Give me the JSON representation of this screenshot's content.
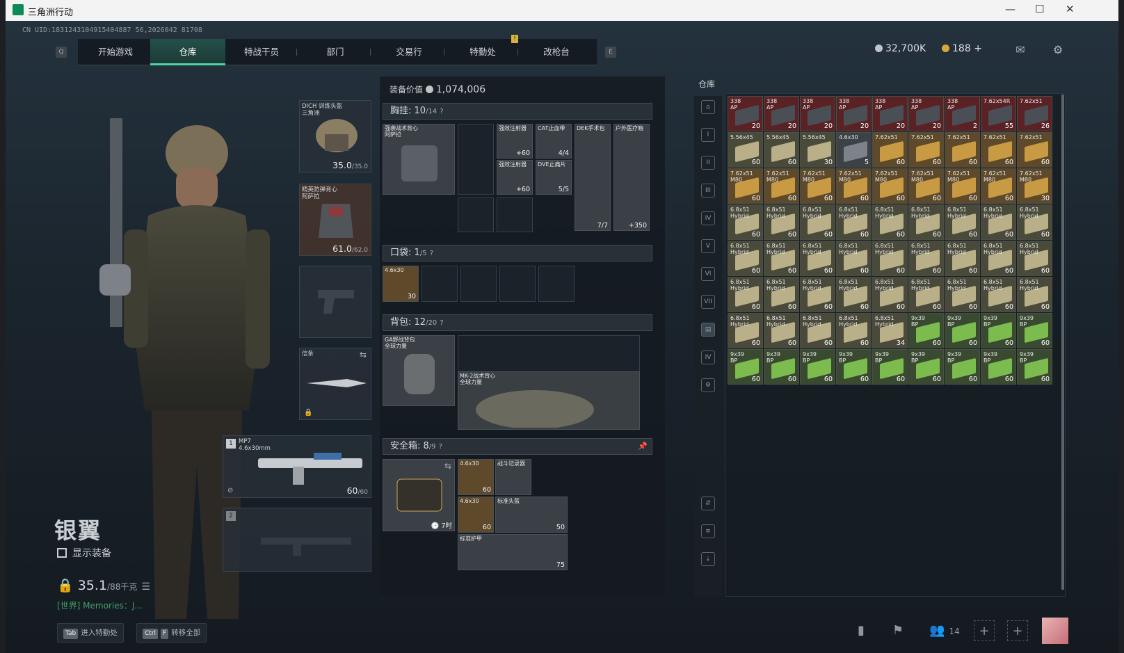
{
  "window": {
    "title": "三角洲行动",
    "min": "—",
    "max": "☐",
    "close": "✕"
  },
  "uid": "CN UID:1831243104915404887 56,2026042 81708",
  "nav": {
    "hint_left": "Q",
    "hint_right": "E",
    "badge": "!",
    "tabs": [
      "开始游戏",
      "仓库",
      "特战干员",
      "部门",
      "交易行",
      "特勤处",
      "改枪台"
    ],
    "active": 1
  },
  "currency": {
    "silver": "32,700K",
    "gold": "188",
    "gold_plus": "+"
  },
  "icons": {
    "mail": "mail-icon",
    "settings": "gear-icon"
  },
  "character": {
    "name": "银翼",
    "show_equip": "显示装备",
    "weight": "35.1",
    "weight_max": "/88千克",
    "chat": "[世界] Memories：J..."
  },
  "bottom_keys": [
    {
      "key": "Tab",
      "label": "进入特勤处"
    },
    {
      "key1": "Ctrl",
      "key2": "F",
      "label": "转移全部"
    }
  ],
  "bottom_right": {
    "friends": "14"
  },
  "equip": {
    "helmet": {
      "label": "DICH 训练头盔\n三角洲",
      "val": "35.0",
      "max": "/35.0"
    },
    "armor": {
      "label": "精英防弹背心\n阿萨拉",
      "val": "61.0",
      "max": "/62.0"
    },
    "melee": {
      "label": "信条"
    },
    "primary": {
      "slot": "1",
      "label": "MP7",
      "sub": "4.6x30mm",
      "val": "60",
      "max": "/60"
    },
    "secondary": {
      "slot": "2"
    }
  },
  "panel": {
    "value_label": "装备价值",
    "value": "1,074,006",
    "chest": {
      "title": "胸挂:",
      "count": "10",
      "cap": "/14",
      "help": "?"
    },
    "chest_items": [
      {
        "label": "强袭战术背心\n阿萨拉"
      },
      {
        "label": "强效注射器",
        "count": "+60"
      },
      {
        "label": "强效注射器",
        "count": "+60"
      },
      {
        "label": "CAT止血带",
        "count": "4/4"
      },
      {
        "label": "DVE止痛片",
        "count": "5/5"
      },
      {
        "label": "DEK手术包",
        "count": "7/7"
      },
      {
        "label": "户外医疗箱",
        "count": "+350"
      }
    ],
    "pocket": {
      "title": "口袋:",
      "count": "1",
      "cap": "/5",
      "help": "?",
      "item": {
        "label": "4.6x30",
        "count": "30"
      }
    },
    "backpack": {
      "title": "背包:",
      "count": "12",
      "cap": "/20",
      "help": "?",
      "item": {
        "label": "GA野战背包\n全球力量"
      },
      "inner": {
        "label": "MK-2战术背心\n全球力量"
      }
    },
    "safe": {
      "title": "安全箱:",
      "count": "8",
      "cap": "/9",
      "help": "?",
      "timer": "7时",
      "items": [
        {
          "label": "4.6x30",
          "count": "60"
        },
        {
          "label": "战斗记录器"
        },
        {
          "label": "4.6x30",
          "count": "60"
        },
        {
          "label": "标准头盔",
          "count": "50"
        },
        {
          "label": "标准护甲",
          "count": "75"
        }
      ]
    }
  },
  "stash": {
    "title": "仓库",
    "items": [
      {
        "l": "338\nAP",
        "c": "20",
        "t": "red"
      },
      {
        "l": "338\nAP",
        "c": "20",
        "t": "red"
      },
      {
        "l": "338\nAP",
        "c": "20",
        "t": "red"
      },
      {
        "l": "338\nAP",
        "c": "20",
        "t": "red"
      },
      {
        "l": "338\nAP",
        "c": "20",
        "t": "red"
      },
      {
        "l": "338\nAP",
        "c": "20",
        "t": "red"
      },
      {
        "l": "338\nAP",
        "c": "2",
        "t": "red"
      },
      {
        "l": "7.62x54R",
        "c": "55",
        "t": "red"
      },
      {
        "l": "7.62x51",
        "c": "26",
        "t": "red"
      },
      {
        "l": "5.56x45",
        "c": "60",
        "t": "ap"
      },
      {
        "l": "5.56x45",
        "c": "60",
        "t": "ap"
      },
      {
        "l": "5.56x45",
        "c": "30",
        "t": "ap"
      },
      {
        "l": "4.6x30",
        "c": "5",
        "t": "gray"
      },
      {
        "l": "7.62x51",
        "c": "60",
        "t": "box"
      },
      {
        "l": "7.62x51",
        "c": "60",
        "t": "box"
      },
      {
        "l": "7.62x51",
        "c": "60",
        "t": "box"
      },
      {
        "l": "7.62x51",
        "c": "60",
        "t": "box"
      },
      {
        "l": "7.62x51",
        "c": "60",
        "t": "box"
      },
      {
        "l": "7.62x51\nM80",
        "c": "60",
        "t": "box"
      },
      {
        "l": "7.62x51\nM80",
        "c": "60",
        "t": "box"
      },
      {
        "l": "7.62x51\nM80",
        "c": "60",
        "t": "box"
      },
      {
        "l": "7.62x51\nM80",
        "c": "60",
        "t": "box"
      },
      {
        "l": "7.62x51\nM80",
        "c": "60",
        "t": "box"
      },
      {
        "l": "7.62x51\nM80",
        "c": "60",
        "t": "box"
      },
      {
        "l": "7.62x51\nM80",
        "c": "60",
        "t": "box"
      },
      {
        "l": "7.62x51\nM80",
        "c": "60",
        "t": "box"
      },
      {
        "l": "7.62x51\nM80",
        "c": "30",
        "t": "box"
      },
      {
        "l": "6.8x51\nHybrid",
        "c": "60",
        "t": "ap"
      },
      {
        "l": "6.8x51\nHybrid",
        "c": "60",
        "t": "ap"
      },
      {
        "l": "6.8x51\nHybrid",
        "c": "60",
        "t": "ap"
      },
      {
        "l": "6.8x51\nHybrid",
        "c": "60",
        "t": "ap"
      },
      {
        "l": "6.8x51\nHybrid",
        "c": "60",
        "t": "ap"
      },
      {
        "l": "6.8x51\nHybrid",
        "c": "60",
        "t": "ap"
      },
      {
        "l": "6.8x51\nHybrid",
        "c": "60",
        "t": "ap"
      },
      {
        "l": "6.8x51\nHybrid",
        "c": "60",
        "t": "ap"
      },
      {
        "l": "6.8x51\nHybrid",
        "c": "60",
        "t": "ap"
      },
      {
        "l": "6.8x51\nHybrid",
        "c": "60",
        "t": "ap"
      },
      {
        "l": "6.8x51\nHybrid",
        "c": "60",
        "t": "ap"
      },
      {
        "l": "6.8x51\nHybrid",
        "c": "60",
        "t": "ap"
      },
      {
        "l": "6.8x51\nHybrid",
        "c": "60",
        "t": "ap"
      },
      {
        "l": "6.8x51\nHybrid",
        "c": "60",
        "t": "ap"
      },
      {
        "l": "6.8x51\nHybrid",
        "c": "60",
        "t": "ap"
      },
      {
        "l": "6.8x51\nHybrid",
        "c": "60",
        "t": "ap"
      },
      {
        "l": "6.8x51\nHybrid",
        "c": "60",
        "t": "ap"
      },
      {
        "l": "6.8x51\nHybrid",
        "c": "60",
        "t": "ap"
      },
      {
        "l": "6.8x51\nHybrid",
        "c": "60",
        "t": "ap"
      },
      {
        "l": "6.8x51\nHybrid",
        "c": "60",
        "t": "ap"
      },
      {
        "l": "6.8x51\nHybrid",
        "c": "60",
        "t": "ap"
      },
      {
        "l": "6.8x51\nHybrid",
        "c": "60",
        "t": "ap"
      },
      {
        "l": "6.8x51\nHybrid",
        "c": "60",
        "t": "ap"
      },
      {
        "l": "6.8x51\nHybrid",
        "c": "60",
        "t": "ap"
      },
      {
        "l": "6.8x51\nHybrid",
        "c": "60",
        "t": "ap"
      },
      {
        "l": "6.8x51\nHybrid",
        "c": "60",
        "t": "ap"
      },
      {
        "l": "6.8x51\nHybrid",
        "c": "60",
        "t": "ap"
      },
      {
        "l": "6.8x51\nHybrid",
        "c": "60",
        "t": "ap"
      },
      {
        "l": "6.8x51\nHybrid",
        "c": "60",
        "t": "ap"
      },
      {
        "l": "6.8x51\nHybrid",
        "c": "60",
        "t": "ap"
      },
      {
        "l": "6.8x51\nHybrid",
        "c": "60",
        "t": "ap"
      },
      {
        "l": "6.8x51\nHybrid",
        "c": "34",
        "t": "ap"
      },
      {
        "l": "9x39\nBP",
        "c": "60",
        "t": "green"
      },
      {
        "l": "9x39\nBP",
        "c": "60",
        "t": "green"
      },
      {
        "l": "9x39\nBP",
        "c": "60",
        "t": "green"
      },
      {
        "l": "9x39\nBP",
        "c": "60",
        "t": "green"
      },
      {
        "l": "9x39\nBP",
        "c": "60",
        "t": "green"
      },
      {
        "l": "9x39\nBP",
        "c": "60",
        "t": "green"
      },
      {
        "l": "9x39\nBP",
        "c": "60",
        "t": "green"
      },
      {
        "l": "9x39\nBP",
        "c": "60",
        "t": "green"
      },
      {
        "l": "9x39\nBP",
        "c": "60",
        "t": "green"
      },
      {
        "l": "9x39\nBP",
        "c": "60",
        "t": "green"
      },
      {
        "l": "9x39\nBP",
        "c": "60",
        "t": "green"
      },
      {
        "l": "9x39\nBP",
        "c": "60",
        "t": "green"
      },
      {
        "l": "9x39\nBP",
        "c": "60",
        "t": "green"
      }
    ]
  },
  "colors": {
    "accent": "#4fd2a6",
    "red_bg": "#5b2226",
    "ammo_bg": "#4a4a3b",
    "box_bg": "#5e4a2a",
    "green_bg": "#3a5a2e"
  }
}
